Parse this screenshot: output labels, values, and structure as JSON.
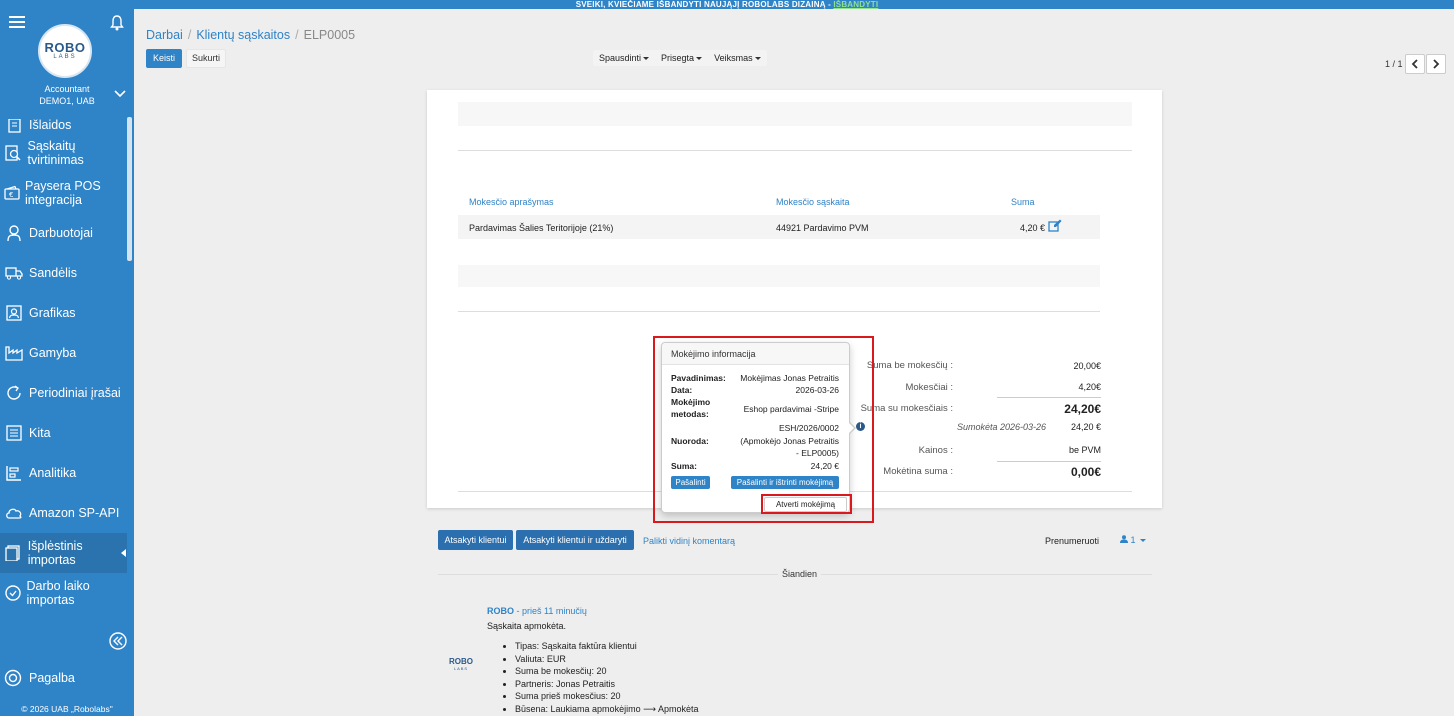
{
  "banner": {
    "text": "SVEIKI, KVIEČIAME IŠBANDYTI NAUJĄJĮ ROBOLABS DIZAINĄ - ",
    "link": "IŠBANDYTI"
  },
  "sidebar": {
    "logo_main": "ROBO",
    "logo_sub": "LABS",
    "role": "Accountant",
    "company": "DEMO1, UAB",
    "items": [
      {
        "label": "Išlaidos",
        "icon": "receipt-icon"
      },
      {
        "label": "Sąskaitų tvirtinimas",
        "icon": "eye-icon"
      },
      {
        "label": "Paysera POS integracija",
        "icon": "wallet-icon"
      },
      {
        "label": "Darbuotojai",
        "icon": "user-icon"
      },
      {
        "label": "Sandėlis",
        "icon": "truck-icon"
      },
      {
        "label": "Grafikas",
        "icon": "calendar-user-icon"
      },
      {
        "label": "Gamyba",
        "icon": "factory-icon"
      },
      {
        "label": "Periodiniai įrašai",
        "icon": "refresh-icon"
      },
      {
        "label": "Kita",
        "icon": "list-icon"
      },
      {
        "label": "Analitika",
        "icon": "chart-icon"
      },
      {
        "label": "Amazon SP-API",
        "icon": "cloud-icon"
      },
      {
        "label": "Išplėstinis importas",
        "icon": "document-icon"
      },
      {
        "label": "Darbo laiko importas",
        "icon": "clock-icon"
      }
    ],
    "help": "Pagalba",
    "copyright": "© 2026 UAB „Robolabs\""
  },
  "breadcrumb": {
    "b1": "Darbai",
    "b2": "Klientų sąskaitos",
    "b3": "ELP0005"
  },
  "actions": {
    "edit": "Keisti",
    "create": "Sukurti"
  },
  "toolbar": {
    "print": "Spausdinti",
    "attach": "Prisegta",
    "action": "Veiksmas"
  },
  "pager": {
    "text": "1 / 1"
  },
  "tax_table": {
    "headers": [
      "Mokesčio aprašymas",
      "Mokesčio sąskaita",
      "Suma"
    ],
    "row": {
      "desc": "Pardavimas Šalies Teritorijoje (21%)",
      "account": "44921 Pardavimo PVM",
      "amount": "4,20 €"
    }
  },
  "totals": {
    "untaxed_label": "Suma be mokesčių :",
    "untaxed": "20,00€",
    "taxes_label": "Mokesčiai :",
    "taxes": "4,20€",
    "total_label": "Suma su mokesčiais :",
    "total": "24,20€",
    "paid_label": "Sumokėta 2026-03-26",
    "paid": "24,20 €",
    "prices_label": "Kainos :",
    "prices": "be PVM",
    "due_label": "Mokėtina suma :",
    "due": "0,00€"
  },
  "popover": {
    "title": "Mokėjimo informacija",
    "name_label": "Pavadinimas:",
    "name": "Mokėjimas Jonas Petraitis",
    "date_label": "Data:",
    "date": "2026-03-26",
    "method_label1": "Mokėjimo",
    "method_label2": "metodas:",
    "method": "Eshop pardavimai -Stripe",
    "ref_label": "Nuoroda:",
    "ref1": "ESH/2026/0002",
    "ref2": "(Apmokėjo Jonas Petraitis",
    "ref3": "- ELP0005)",
    "amount_label": "Suma:",
    "amount": "24,20 €",
    "btn_remove": "Pašalinti",
    "btn_remove_delete": "Pašalinti ir ištrinti mokėjimą",
    "btn_open": "Atverti mokėjimą"
  },
  "chatter": {
    "reply": "Atsakyti klientui",
    "reply_close": "Atsakyti klientui ir uždaryti",
    "note": "Palikti vidinį komentarą",
    "subscribe": "Prenumeruoti",
    "followers": "1",
    "today": "Šiandien",
    "author": "ROBO",
    "time": " - prieš 11 minučių",
    "title": "Sąskaita apmokėta.",
    "lines": [
      "Tipas: Sąskaita faktūra klientui",
      "Valiuta: EUR",
      "Suma be mokesčių: 20",
      "Partneris: Jonas Petraitis",
      "Suma prieš mokesčius: 20",
      "Būsena: Laukiama apmokėjimo ⟶ Apmokėta"
    ]
  },
  "colors": {
    "brand": "#2f83c7",
    "highlight": "#d9191c"
  }
}
